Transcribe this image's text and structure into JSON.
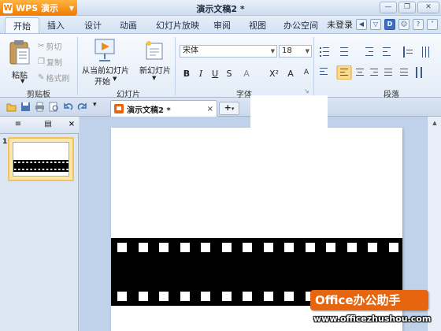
{
  "titlebar": {
    "app_button": "WPS 演示",
    "document_title": "演示文稿2 *"
  },
  "menu": {
    "items": [
      "开始",
      "插入",
      "设计",
      "动画",
      "幻灯片放映",
      "审阅",
      "视图",
      "办公空间"
    ],
    "active": "开始",
    "login": "未登录"
  },
  "ribbon": {
    "clipboard": {
      "paste": "粘贴",
      "cut": "剪切",
      "copy": "复制",
      "format_painter": "格式刷",
      "group_label": "剪贴板"
    },
    "slides": {
      "from_current_line1": "从当前幻灯片",
      "from_current_line2": "开始",
      "new_slide": "新幻灯片",
      "group_label": "幻灯片"
    },
    "font": {
      "font_name": "宋体",
      "font_size": "18",
      "group_label": "字体",
      "bold": "B",
      "italic": "I",
      "underline": "U",
      "strike": "S",
      "color_a": "A",
      "superscript": "X²",
      "grow": "A",
      "shrink": "A"
    },
    "paragraph": {
      "group_label": "段落"
    }
  },
  "tabs": {
    "document_tab": "演示文稿2 *",
    "close": "×",
    "new_tab": "+"
  },
  "thumbnail": {
    "number": "1"
  },
  "watermark": {
    "brand": "Office办公助手",
    "url": "www.officezhushou.com"
  }
}
